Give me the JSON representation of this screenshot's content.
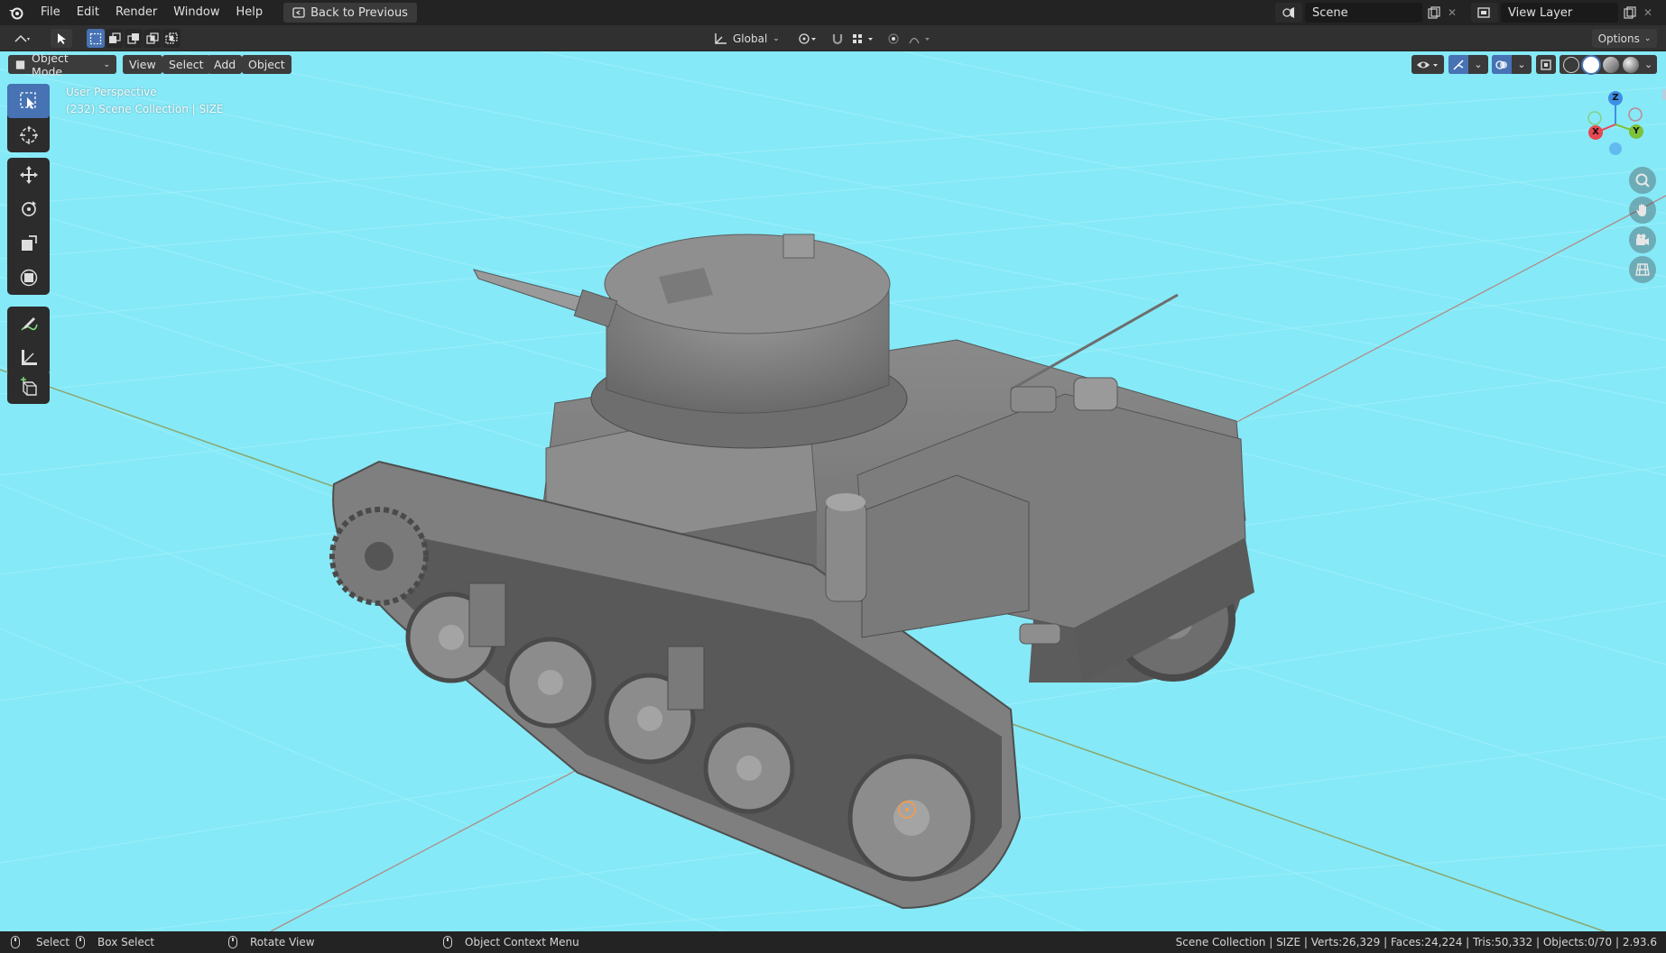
{
  "menu": {
    "items": [
      "File",
      "Edit",
      "Render",
      "Window",
      "Help"
    ],
    "back_label": "Back to Previous"
  },
  "workspace": {
    "scene_label": "Scene",
    "view_layer_label": "View Layer"
  },
  "tool_header": {
    "orientation": "Global",
    "options_label": "Options"
  },
  "viewport_header": {
    "mode": "Object Mode",
    "menus": [
      "View",
      "Select",
      "Add",
      "Object"
    ]
  },
  "overlay": {
    "line1": "User Perspective",
    "line2": "(232) Scene Collection | SIZE"
  },
  "gizmo": {
    "z": "Z",
    "y": "Y",
    "x": "X"
  },
  "statusbar": {
    "select": "Select",
    "box_select": "Box Select",
    "rotate_view": "Rotate View",
    "context_menu": "Object Context Menu",
    "stats": "Scene Collection | SIZE | Verts:26,329 | Faces:24,224 | Tris:50,332 | Objects:0/70 | 2.93.6"
  },
  "colors": {
    "viewport_bg": "#86e9f7",
    "active_blue": "#4772b3",
    "axis_x": "#e8474f",
    "axis_y": "#7dc23b",
    "axis_z": "#3d8ee6"
  }
}
